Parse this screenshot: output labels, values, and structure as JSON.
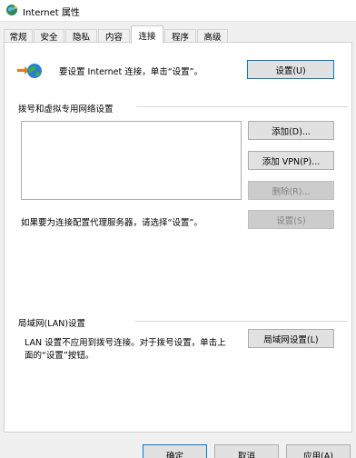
{
  "window": {
    "title": "Internet 属性"
  },
  "tabs": [
    {
      "label": "常规"
    },
    {
      "label": "安全"
    },
    {
      "label": "隐私"
    },
    {
      "label": "内容"
    },
    {
      "label": "连接",
      "active": true
    },
    {
      "label": "程序"
    },
    {
      "label": "高级"
    }
  ],
  "setup": {
    "text": "要设置 Internet 连接，单击“设置”。",
    "button": "设置(U)"
  },
  "dialup": {
    "heading": "拨号和虚拟专用网络设置",
    "add_button": "添加(D)...",
    "add_vpn_button": "添加 VPN(P)...",
    "delete_button": "删除(R)...",
    "settings_button": "设置(S)",
    "proxy_note": "如果要为连接配置代理服务器，请选择“设置”。"
  },
  "lan": {
    "heading": "局域网(LAN)设置",
    "note_line1": "LAN 设置不应用到拨号连接。对于拨号设置，单击上",
    "note_line2": "面的“设置”按钮。",
    "button": "局域网设置(L)"
  },
  "footer": {
    "ok": "确定",
    "cancel": "取消",
    "apply": "应用(A)"
  },
  "colors": {
    "accent": "#0078d7",
    "background": "#f0f0f0",
    "panel": "#ffffff"
  }
}
